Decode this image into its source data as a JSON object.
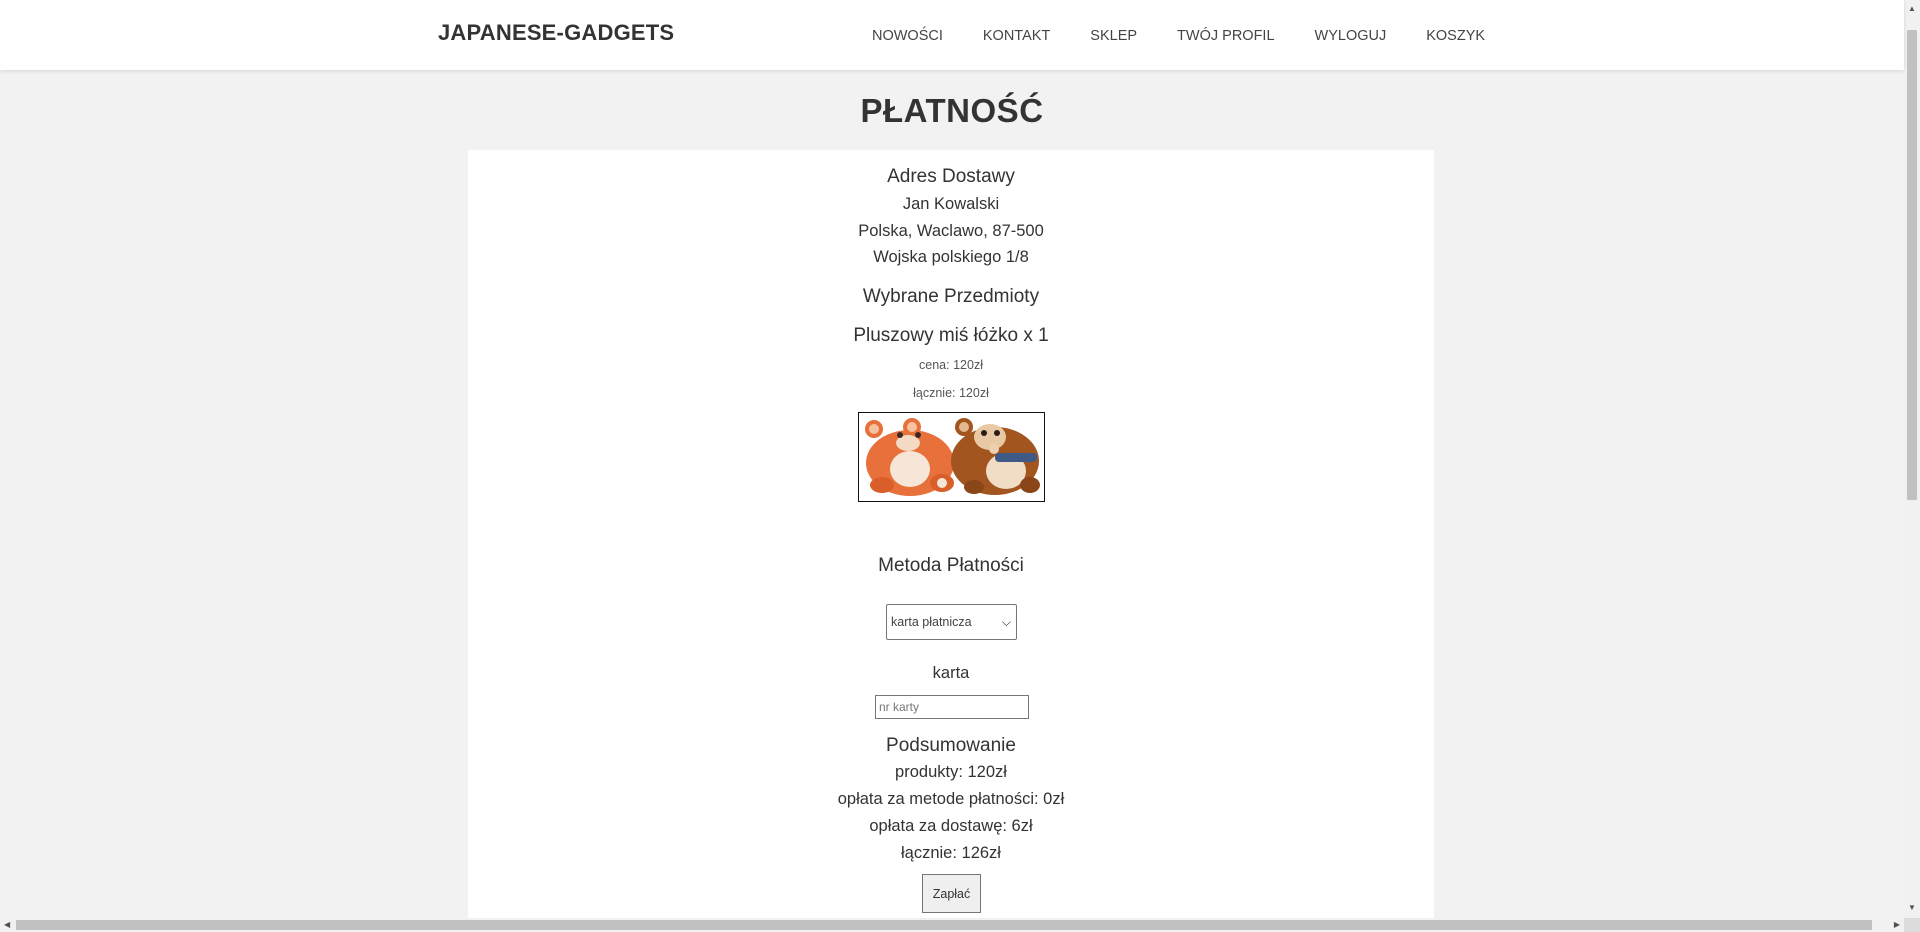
{
  "navbar": {
    "brand": "JAPANESE-GADGETS",
    "links": [
      "NOWOŚCI",
      "KONTAKT",
      "SKLEP",
      "TWÓJ PROFIL",
      "WYLOGUJ",
      "KOSZYK"
    ]
  },
  "page": {
    "title": "PŁATNOŚĆ"
  },
  "address": {
    "heading": "Adres Dostawy",
    "name": "Jan Kowalski",
    "city_line": "Polska, Waclawo, 87-500",
    "street": "Wojska polskiego 1/8"
  },
  "items": {
    "heading": "Wybrane Przedmioty",
    "list": [
      {
        "title": "Pluszowy miś łóżko x 1",
        "price": "cena: 120zł",
        "total": "łącznie: 120zł"
      }
    ]
  },
  "payment": {
    "heading": "Metoda Płatności",
    "selected": "karta płatnicza",
    "card_label": "karta",
    "card_placeholder": "nr karty",
    "card_value": ""
  },
  "summary": {
    "heading": "Podsumowanie",
    "products": "produkty: 120zł",
    "payment_fee": "opłata za metode płatności: 0zł",
    "delivery_fee": "opłata za dostawę: 6zł",
    "total": "łącznie: 126zł",
    "pay_button": "Zapłać"
  },
  "colors": {
    "page_background": "#f2f2f2",
    "panel_background": "#ffffff",
    "text": "#333333",
    "bear_orange": "#e8703a",
    "bear_brown": "#a2551f"
  }
}
